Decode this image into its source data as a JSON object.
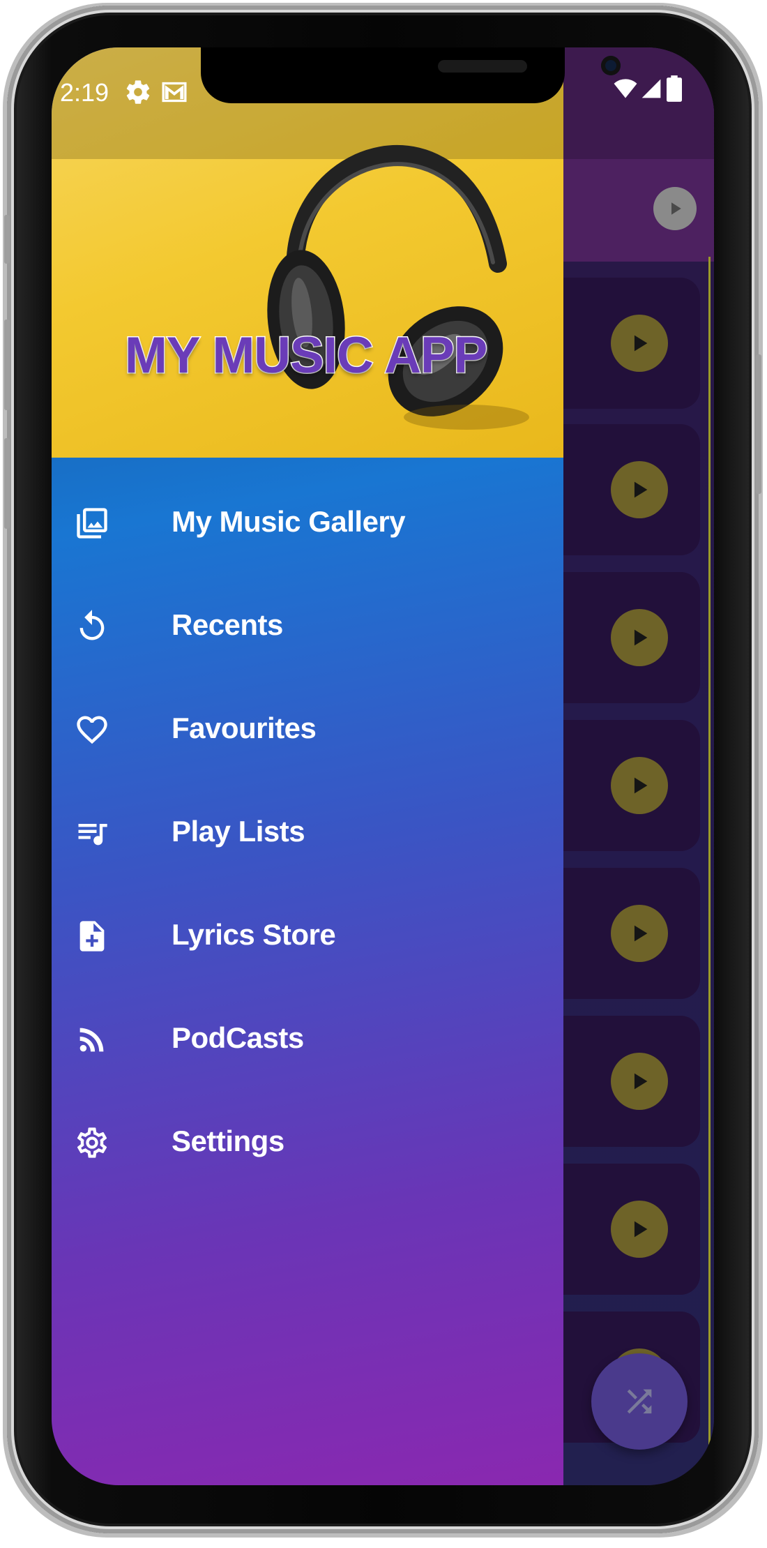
{
  "status_bar": {
    "time": "2:19"
  },
  "drawer": {
    "title": "MY MUSIC APP",
    "items": [
      {
        "label": "My Music Gallery",
        "icon": "gallery-icon"
      },
      {
        "label": "Recents",
        "icon": "history-icon"
      },
      {
        "label": "Favourites",
        "icon": "heart-icon"
      },
      {
        "label": "Play Lists",
        "icon": "playlist-icon"
      },
      {
        "label": "Lyrics Store",
        "icon": "file-add-icon"
      },
      {
        "label": "PodCasts",
        "icon": "rss-icon"
      },
      {
        "label": "Settings",
        "icon": "gear-icon"
      }
    ]
  },
  "colors": {
    "title": "#6a3cb8",
    "header_yellow": "#f3c930",
    "drawer_top": "#1976d2",
    "drawer_bottom": "#8a28b0",
    "play_button": "#6e6328"
  }
}
